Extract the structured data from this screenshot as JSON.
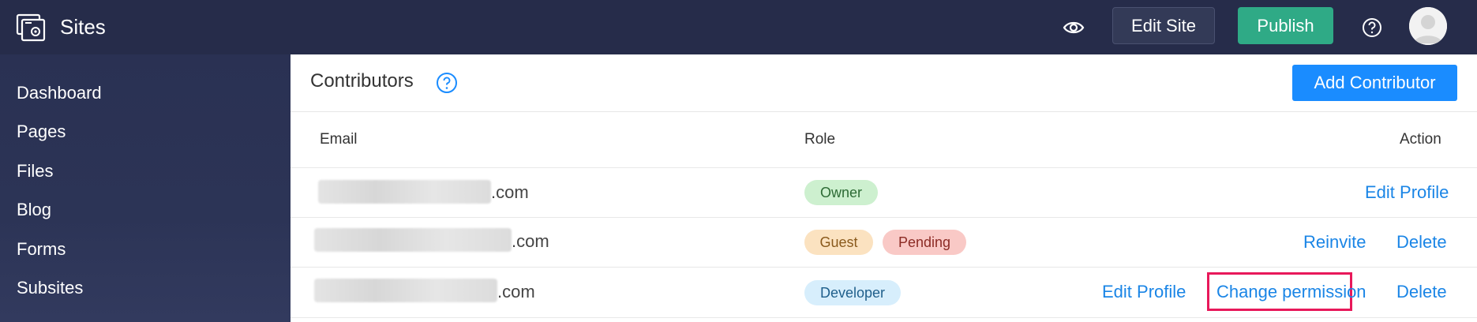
{
  "app": {
    "title": "Sites"
  },
  "toolbar": {
    "edit_site_label": "Edit Site",
    "publish_label": "Publish"
  },
  "sidebar": {
    "items": [
      {
        "label": "Dashboard"
      },
      {
        "label": "Pages"
      },
      {
        "label": "Files"
      },
      {
        "label": "Blog"
      },
      {
        "label": "Forms"
      },
      {
        "label": "Subsites"
      }
    ]
  },
  "main": {
    "title": "Contributors",
    "add_button_label": "Add Contributor",
    "columns": {
      "email": "Email",
      "role": "Role",
      "action": "Action"
    },
    "rows": [
      {
        "email_suffix": ".com",
        "roles": [
          "Owner"
        ],
        "actions": [
          "Edit Profile"
        ]
      },
      {
        "email_suffix": ".com",
        "roles": [
          "Guest",
          "Pending"
        ],
        "actions": [
          "Reinvite",
          "Delete"
        ]
      },
      {
        "email_suffix": ".com",
        "roles": [
          "Developer"
        ],
        "actions": [
          "Edit Profile",
          "Change permission",
          "Delete"
        ]
      }
    ]
  },
  "colors": {
    "topbar": "#262c4a",
    "publish": "#2faa86",
    "primary": "#1a8cff",
    "highlight": "#e8185a"
  }
}
